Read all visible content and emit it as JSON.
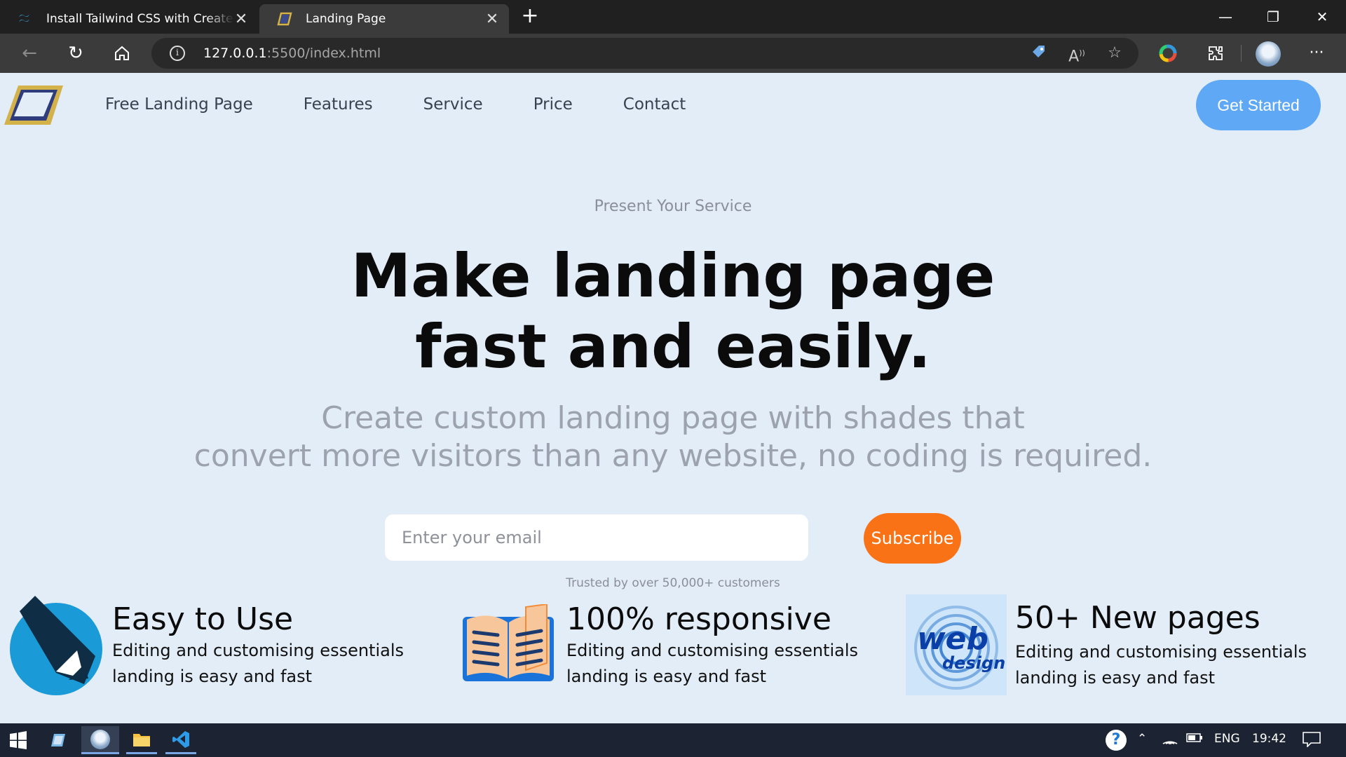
{
  "browser": {
    "tabs": [
      {
        "title": "Install Tailwind CSS with Create React App - Tailwind CSS"
      },
      {
        "title": "Landing Page"
      }
    ],
    "url_host": "127.0.0.1",
    "url_path": ":5500/index.html",
    "new_tab": "+",
    "more": "···"
  },
  "nav": {
    "links": [
      "Free Landing Page",
      "Features",
      "Service",
      "Price",
      "Contact"
    ],
    "cta": "Get Started"
  },
  "hero": {
    "eyebrow": "Present Your Service",
    "title_line1": "Make landing page",
    "title_line2": "fast and easily.",
    "subtitle_line1": "Create custom landing page with shades that",
    "subtitle_line2": "convert more visitors than any website, no coding is required."
  },
  "signup": {
    "email_placeholder": "Enter your email",
    "button": "Subscribe",
    "trusted": "Trusted by over 50,000+ customers"
  },
  "features": [
    {
      "title": "Easy to Use",
      "text": "Editing and customising essentials landing is easy and fast",
      "icon": "pencil-icon"
    },
    {
      "title": "100% responsive",
      "text": "Editing and customising essentials landing is easy and fast",
      "icon": "open-book-icon"
    },
    {
      "title": "50+ New pages",
      "text": "Editing and customising essentials landing is easy and fast",
      "icon": "web-design-logo"
    }
  ],
  "web_logo_text": {
    "line1": "web",
    "line2": "design"
  },
  "taskbar": {
    "lang": "ENG",
    "time": "19:42"
  },
  "colors": {
    "page_bg": "#e3edf8",
    "cta_blue": "#5fa8f5",
    "subscribe_orange": "#f97316",
    "chrome_dark": "#202020"
  }
}
